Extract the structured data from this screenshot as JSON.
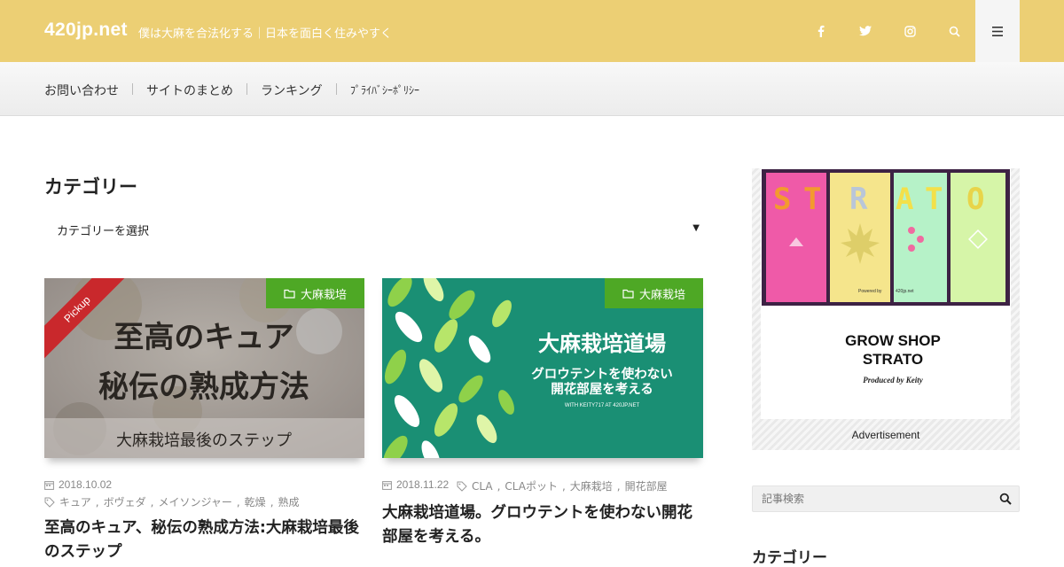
{
  "header": {
    "logo": "420jp.net",
    "tagline": "僕は大麻を合法化する｜日本を面白く住みやすく",
    "icons": [
      "facebook-icon",
      "twitter-icon",
      "instagram-icon",
      "search-icon",
      "menu-icon"
    ],
    "bg_color": "#eccf74"
  },
  "nav": {
    "items": [
      {
        "label": "お問い合わせ"
      },
      {
        "label": "サイトのまとめ"
      },
      {
        "label": "ランキング"
      },
      {
        "label": "ﾌﾟﾗｲﾊﾞｼｰﾎﾟﾘｼｰ"
      }
    ]
  },
  "main": {
    "category_heading": "カテゴリー",
    "category_select": "カテゴリーを選択",
    "cards": [
      {
        "category": "大麻栽培",
        "ribbon": "Pickup",
        "image_title_line1": "至高のキュア",
        "image_title_line2": "秘伝の熟成方法",
        "image_caption": "大麻栽培最後のステップ",
        "date": "2018.10.02",
        "tags": [
          "キュア",
          "ボヴェダ",
          "メイソンジャー",
          "乾燥",
          "熟成"
        ],
        "title": "至高のキュア、秘伝の熟成方法:大麻栽培最後のステップ"
      },
      {
        "category": "大麻栽培",
        "image_title": "大麻栽培道場",
        "image_sub_line1": "グロウテントを使わない",
        "image_sub_line2": "開花部屋を考える",
        "image_credit": "WITH KEITY717 AT 420JP.NET",
        "date": "2018.11.22",
        "tags": [
          "CLA",
          "CLAポット",
          "大麻栽培",
          "開花部屋"
        ],
        "title": "大麻栽培道場。グロウテントを使わない開花部屋を考える。"
      }
    ],
    "accent_green": "#4ea825",
    "ribbon_red": "#c9282c"
  },
  "sidebar": {
    "ad": {
      "letters": [
        "S",
        "T",
        "R",
        "A",
        "T",
        "O"
      ],
      "panel_credit_1": "Powered by",
      "panel_credit_2": "420jp.net",
      "shop_line1": "GROW SHOP",
      "shop_line2": "STRATO",
      "produced": "Produced by Keity",
      "label": "Advertisement"
    },
    "search_placeholder": "記事検索",
    "category_heading": "カテゴリー"
  }
}
